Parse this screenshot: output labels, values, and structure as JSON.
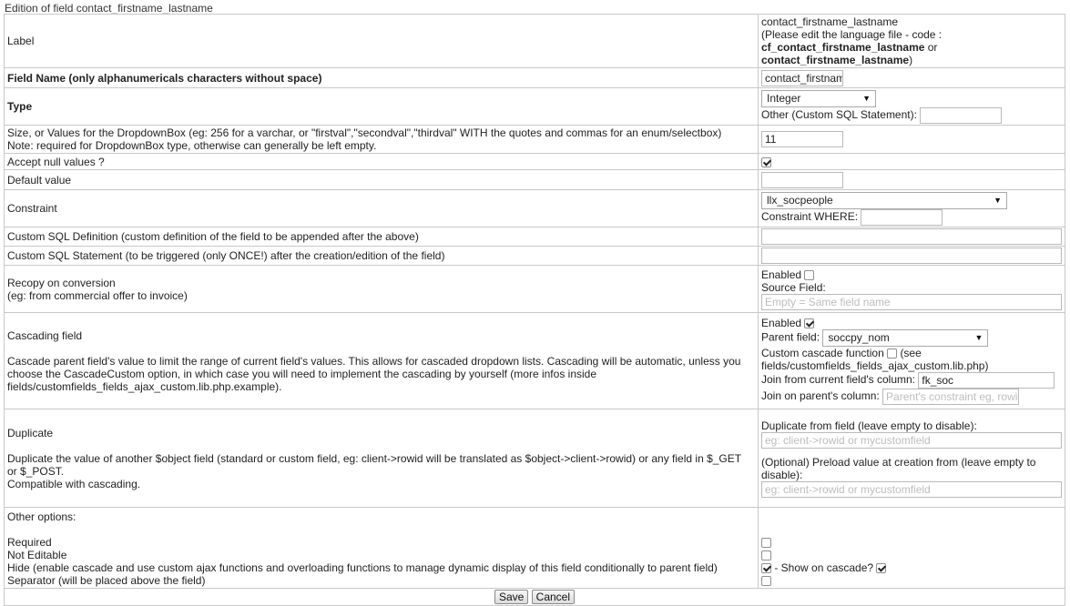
{
  "caption": "Edition of field contact_firstname_lastname",
  "label": {
    "title": "Label",
    "value": "contact_firstname_lastname",
    "note_prefix": "(Please edit the language file - code :",
    "code1": "cf_contact_firstname_lastname",
    "or": " or",
    "code2": "contact_firstname_lastname",
    "close": ")"
  },
  "field_name": {
    "title": "Field Name (only alphanumericals characters without space)",
    "value": "contact_firstnam"
  },
  "type": {
    "title": "Type",
    "selected": "Integer",
    "other_label": "Other (Custom SQL Statement):",
    "other_value": ""
  },
  "size": {
    "title": "Size, or Values for the DropdownBox (eg: 256 for a varchar, or \"firstval\",\"secondval\",\"thirdval\" WITH the quotes and commas for an enum/selectbox)",
    "note": "Note: required for DropdownBox type, otherwise can generally be left empty.",
    "value": "11"
  },
  "accept_null": {
    "title": "Accept null values ?",
    "checked": true
  },
  "default_value": {
    "title": "Default value",
    "value": ""
  },
  "constraint": {
    "title": "Constraint",
    "selected": "llx_socpeople",
    "where_label": "Constraint WHERE:",
    "where_value": ""
  },
  "custom_sql_def": {
    "title": "Custom SQL Definition (custom definition of the field to be appended after the above)",
    "value": ""
  },
  "custom_sql_stmt": {
    "title": "Custom SQL Statement (to be triggered (only ONCE!) after the creation/edition of the field)",
    "value": ""
  },
  "recopy": {
    "title": "Recopy on conversion",
    "note": "(eg: from commercial offer to invoice)",
    "enabled_label": "Enabled",
    "enabled": false,
    "source_label": "Source Field:",
    "source_placeholder": "Empty = Same field name"
  },
  "cascading": {
    "title": "Cascading field",
    "desc1": "Cascade parent field's value to limit the range of current field's values. This allows for cascaded dropdown lists. Cascading will be automatic, unless you",
    "desc2": "choose the CascadeCustom option, in which case you will need to implement the cascading by yourself (more infos inside",
    "desc3": "fields/customfields_fields_ajax_custom.lib.php.example).",
    "enabled_label": "Enabled",
    "enabled": true,
    "parent_label": "Parent field:",
    "parent_selected": "soccpy_nom",
    "custom_fn_label": "Custom cascade function",
    "custom_fn_see": "(see",
    "custom_fn_file": "fields/customfields_fields_ajax_custom.lib.php)",
    "join_current_label": "Join from current field's column:",
    "join_current_value": "fk_soc",
    "join_parent_label": "Join on parent's column:",
    "join_parent_placeholder": "Parent's constraint eg, rowid"
  },
  "duplicate": {
    "title": "Duplicate",
    "desc1": "Duplicate the value of another $object field (standard or custom field, eg: client->rowid will be translated as $object->client->rowid) or any field in $_GET",
    "desc2": "or $_POST.",
    "desc3": "Compatible with cascading.",
    "from_label": "Duplicate from field (leave empty to disable):",
    "from_placeholder": "eg: client->rowid or mycustomfield",
    "preload_label1": "(Optional) Preload value at creation from (leave empty to",
    "preload_label2": "disable):",
    "preload_placeholder": "eg: client->rowid or mycustomfield"
  },
  "other": {
    "title": "Other options:",
    "required": "Required",
    "not_editable": "Not Editable",
    "hide": "Hide (enable cascade and use custom ajax functions and overloading functions to manage dynamic display of this field conditionally to parent field)",
    "separator": "Separator (will be placed above the field)",
    "show_on_cascade": " - Show on cascade?"
  },
  "buttons": {
    "save": "Save",
    "cancel": "Cancel"
  }
}
